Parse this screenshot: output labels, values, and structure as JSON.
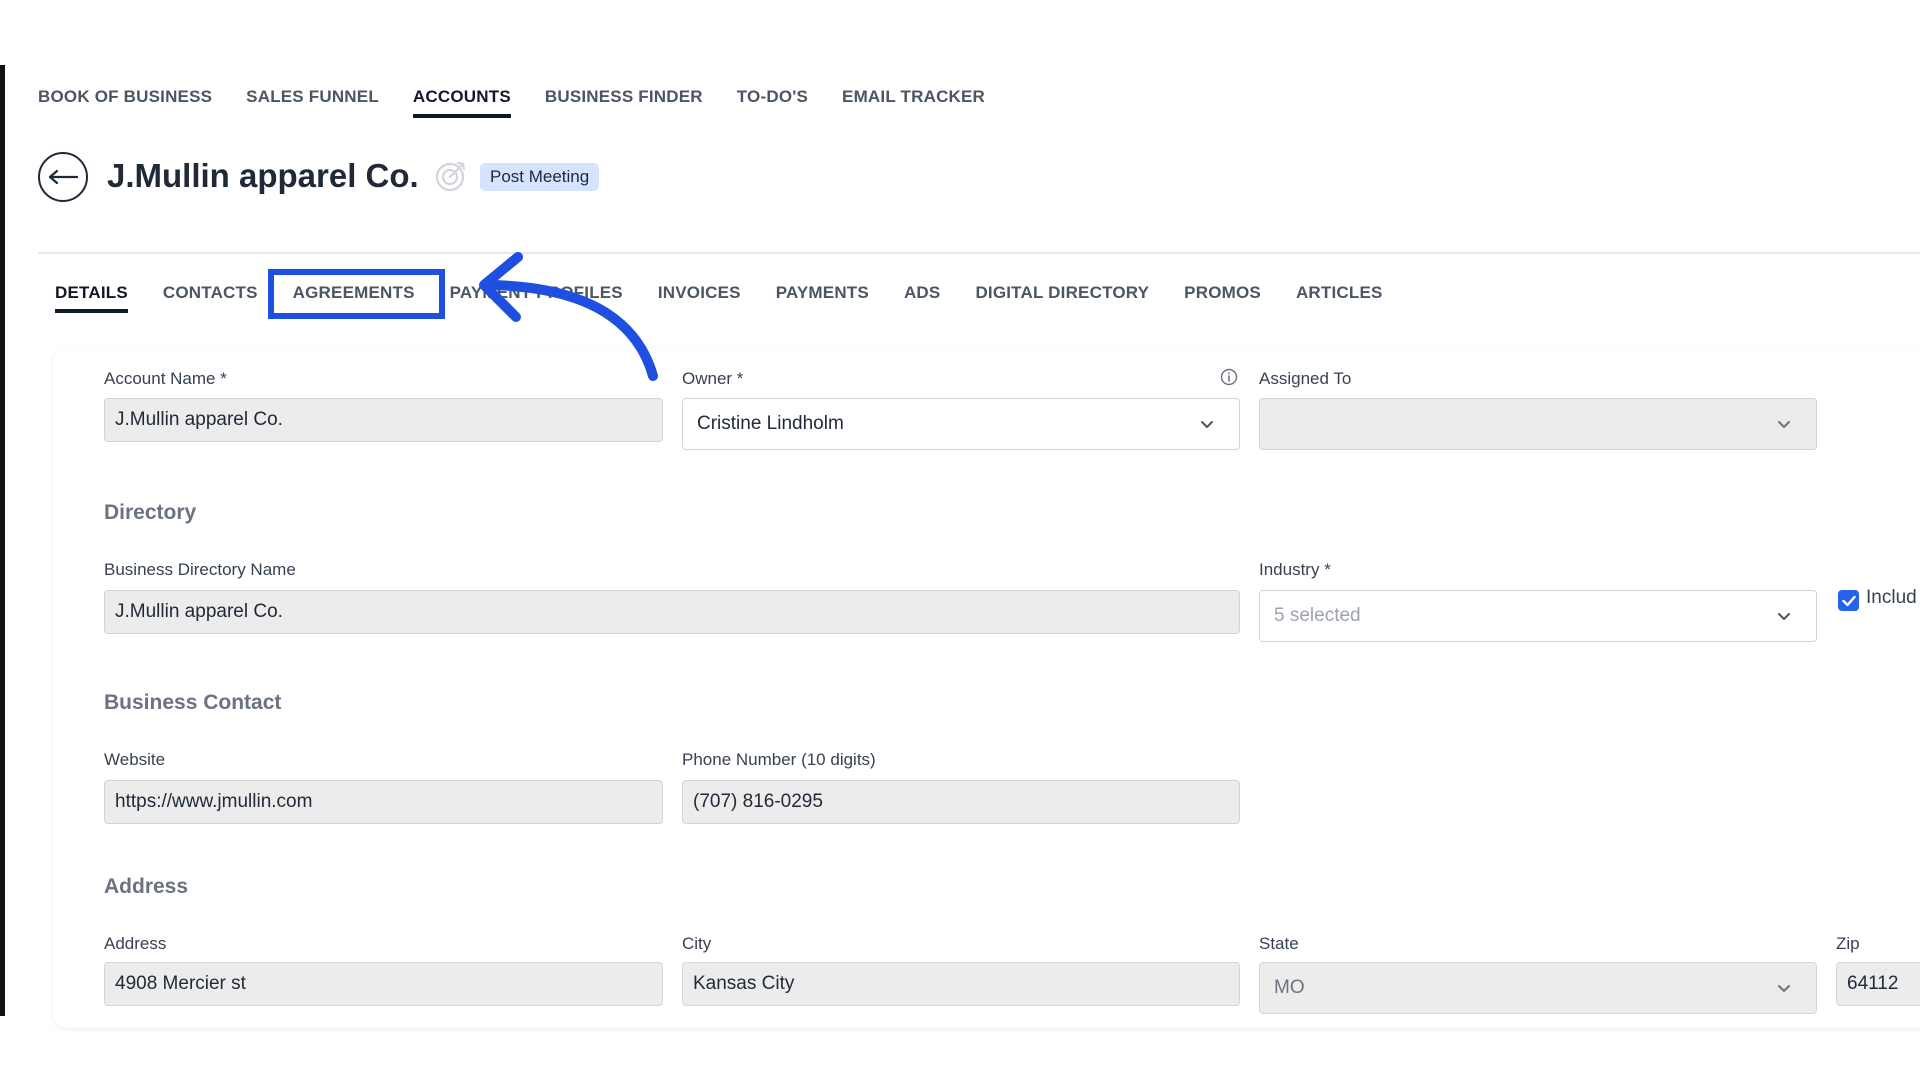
{
  "topnav": {
    "items": [
      "BOOK OF BUSINESS",
      "SALES FUNNEL",
      "ACCOUNTS",
      "BUSINESS FINDER",
      "TO-DO'S",
      "EMAIL TRACKER"
    ],
    "active_index": 2
  },
  "header": {
    "title": "J.Mullin apparel Co.",
    "status": "Post Meeting"
  },
  "subtabs": {
    "items": [
      "DETAILS",
      "CONTACTS",
      "AGREEMENTS",
      "PAYMENT PROFILES",
      "INVOICES",
      "PAYMENTS",
      "ADS",
      "DIGITAL DIRECTORY",
      "PROMOS",
      "ARTICLES"
    ],
    "active_index": 0,
    "highlighted_index": 2
  },
  "form": {
    "account_name_label": "Account Name *",
    "account_name_value": "J.Mullin apparel Co.",
    "owner_label": "Owner *",
    "owner_value": "Cristine Lindholm",
    "assigned_to_label": "Assigned To",
    "assigned_to_value": "",
    "directory_title": "Directory",
    "business_directory_name_label": "Business Directory Name",
    "business_directory_name_value": "J.Mullin apparel Co.",
    "industry_label": "Industry *",
    "industry_placeholder": "5 selected",
    "include_label": "Includ",
    "business_contact_title": "Business Contact",
    "website_label": "Website",
    "website_value": "https://www.jmullin.com",
    "phone_label": "Phone Number (10 digits)",
    "phone_value": "(707) 816-0295",
    "address_title": "Address",
    "address_label": "Address",
    "address_value": "4908 Mercier st",
    "city_label": "City",
    "city_value": "Kansas City",
    "state_label": "State",
    "state_value": "MO",
    "zip_label": "Zip",
    "zip_value": "64112"
  },
  "colors": {
    "highlight": "#1f4fe0",
    "badge_bg": "#d5e3ff",
    "checkbox": "#2563eb"
  }
}
